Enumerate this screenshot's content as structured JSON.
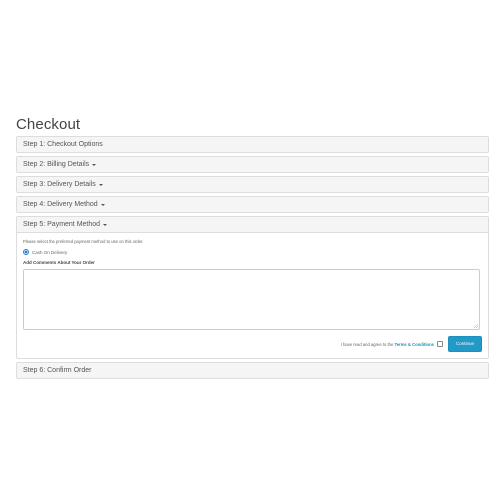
{
  "page": {
    "title": "Checkout"
  },
  "steps": [
    {
      "label": "Step 1: Checkout Options",
      "has_caret": false
    },
    {
      "label": "Step 2: Billing Details",
      "has_caret": true
    },
    {
      "label": "Step 3: Delivery Details",
      "has_caret": true
    },
    {
      "label": "Step 4: Delivery Method",
      "has_caret": true
    },
    {
      "label": "Step 5: Payment Method",
      "has_caret": true,
      "expanded": true
    },
    {
      "label": "Step 6: Confirm Order",
      "has_caret": false
    }
  ],
  "payment": {
    "help_text": "Please select the preferred payment method to use on this order.",
    "option_label": "Cash On Delivery",
    "option_selected": true,
    "comments_label": "Add Comments About Your Order",
    "comments_value": "",
    "agree_prefix": "I have read and agree to the",
    "agree_link": "Terms & Conditions",
    "agree_checked": false,
    "continue_label": "Continue"
  },
  "colors": {
    "accent": "#229ac8",
    "link": "#1f90bb",
    "panel_heading_bg": "#f5f5f5",
    "border": "#dddddd"
  }
}
